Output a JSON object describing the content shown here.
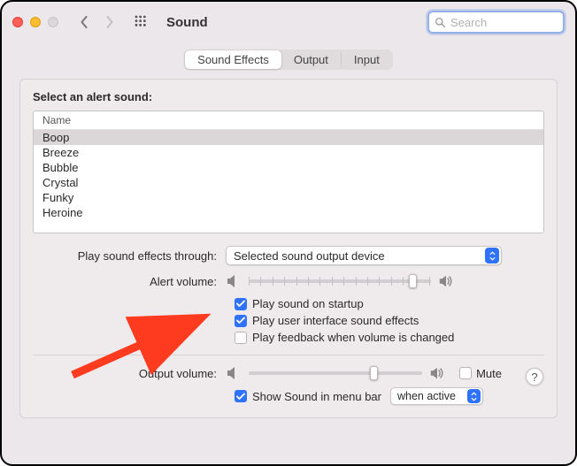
{
  "window": {
    "title": "Sound"
  },
  "search": {
    "placeholder": "Search"
  },
  "tabs": [
    {
      "label": "Sound Effects",
      "active": true
    },
    {
      "label": "Output",
      "active": false
    },
    {
      "label": "Input",
      "active": false
    }
  ],
  "alert_sound": {
    "section_label": "Select an alert sound:",
    "column_header": "Name",
    "items": [
      {
        "name": "Boop",
        "selected": true
      },
      {
        "name": "Breeze",
        "selected": false
      },
      {
        "name": "Bubble",
        "selected": false
      },
      {
        "name": "Crystal",
        "selected": false
      },
      {
        "name": "Funky",
        "selected": false
      },
      {
        "name": "Heroine",
        "selected": false
      }
    ]
  },
  "play_through": {
    "label": "Play sound effects through:",
    "value": "Selected sound output device"
  },
  "alert_volume": {
    "label": "Alert volume:",
    "value_pct": 90
  },
  "checks": {
    "startup": {
      "label": "Play sound on startup",
      "checked": true
    },
    "ui_sounds": {
      "label": "Play user interface sound effects",
      "checked": true
    },
    "feedback": {
      "label": "Play feedback when volume is changed",
      "checked": false
    }
  },
  "output_volume": {
    "label": "Output volume:",
    "value_pct": 72,
    "mute_label": "Mute",
    "mute_checked": false
  },
  "menu_bar": {
    "label": "Show Sound in menu bar",
    "checked": true,
    "dropdown_value": "when active"
  },
  "help_symbol": "?"
}
